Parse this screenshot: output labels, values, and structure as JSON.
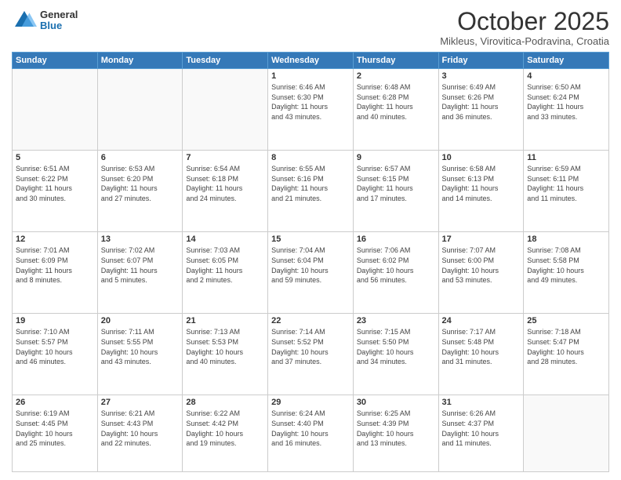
{
  "header": {
    "logo_general": "General",
    "logo_blue": "Blue",
    "month_title": "October 2025",
    "location": "Mikleus, Virovitica-Podravina, Croatia"
  },
  "days_of_week": [
    "Sunday",
    "Monday",
    "Tuesday",
    "Wednesday",
    "Thursday",
    "Friday",
    "Saturday"
  ],
  "weeks": [
    [
      {
        "day": "",
        "info": ""
      },
      {
        "day": "",
        "info": ""
      },
      {
        "day": "",
        "info": ""
      },
      {
        "day": "1",
        "info": "Sunrise: 6:46 AM\nSunset: 6:30 PM\nDaylight: 11 hours\nand 43 minutes."
      },
      {
        "day": "2",
        "info": "Sunrise: 6:48 AM\nSunset: 6:28 PM\nDaylight: 11 hours\nand 40 minutes."
      },
      {
        "day": "3",
        "info": "Sunrise: 6:49 AM\nSunset: 6:26 PM\nDaylight: 11 hours\nand 36 minutes."
      },
      {
        "day": "4",
        "info": "Sunrise: 6:50 AM\nSunset: 6:24 PM\nDaylight: 11 hours\nand 33 minutes."
      }
    ],
    [
      {
        "day": "5",
        "info": "Sunrise: 6:51 AM\nSunset: 6:22 PM\nDaylight: 11 hours\nand 30 minutes."
      },
      {
        "day": "6",
        "info": "Sunrise: 6:53 AM\nSunset: 6:20 PM\nDaylight: 11 hours\nand 27 minutes."
      },
      {
        "day": "7",
        "info": "Sunrise: 6:54 AM\nSunset: 6:18 PM\nDaylight: 11 hours\nand 24 minutes."
      },
      {
        "day": "8",
        "info": "Sunrise: 6:55 AM\nSunset: 6:16 PM\nDaylight: 11 hours\nand 21 minutes."
      },
      {
        "day": "9",
        "info": "Sunrise: 6:57 AM\nSunset: 6:15 PM\nDaylight: 11 hours\nand 17 minutes."
      },
      {
        "day": "10",
        "info": "Sunrise: 6:58 AM\nSunset: 6:13 PM\nDaylight: 11 hours\nand 14 minutes."
      },
      {
        "day": "11",
        "info": "Sunrise: 6:59 AM\nSunset: 6:11 PM\nDaylight: 11 hours\nand 11 minutes."
      }
    ],
    [
      {
        "day": "12",
        "info": "Sunrise: 7:01 AM\nSunset: 6:09 PM\nDaylight: 11 hours\nand 8 minutes."
      },
      {
        "day": "13",
        "info": "Sunrise: 7:02 AM\nSunset: 6:07 PM\nDaylight: 11 hours\nand 5 minutes."
      },
      {
        "day": "14",
        "info": "Sunrise: 7:03 AM\nSunset: 6:05 PM\nDaylight: 11 hours\nand 2 minutes."
      },
      {
        "day": "15",
        "info": "Sunrise: 7:04 AM\nSunset: 6:04 PM\nDaylight: 10 hours\nand 59 minutes."
      },
      {
        "day": "16",
        "info": "Sunrise: 7:06 AM\nSunset: 6:02 PM\nDaylight: 10 hours\nand 56 minutes."
      },
      {
        "day": "17",
        "info": "Sunrise: 7:07 AM\nSunset: 6:00 PM\nDaylight: 10 hours\nand 53 minutes."
      },
      {
        "day": "18",
        "info": "Sunrise: 7:08 AM\nSunset: 5:58 PM\nDaylight: 10 hours\nand 49 minutes."
      }
    ],
    [
      {
        "day": "19",
        "info": "Sunrise: 7:10 AM\nSunset: 5:57 PM\nDaylight: 10 hours\nand 46 minutes."
      },
      {
        "day": "20",
        "info": "Sunrise: 7:11 AM\nSunset: 5:55 PM\nDaylight: 10 hours\nand 43 minutes."
      },
      {
        "day": "21",
        "info": "Sunrise: 7:13 AM\nSunset: 5:53 PM\nDaylight: 10 hours\nand 40 minutes."
      },
      {
        "day": "22",
        "info": "Sunrise: 7:14 AM\nSunset: 5:52 PM\nDaylight: 10 hours\nand 37 minutes."
      },
      {
        "day": "23",
        "info": "Sunrise: 7:15 AM\nSunset: 5:50 PM\nDaylight: 10 hours\nand 34 minutes."
      },
      {
        "day": "24",
        "info": "Sunrise: 7:17 AM\nSunset: 5:48 PM\nDaylight: 10 hours\nand 31 minutes."
      },
      {
        "day": "25",
        "info": "Sunrise: 7:18 AM\nSunset: 5:47 PM\nDaylight: 10 hours\nand 28 minutes."
      }
    ],
    [
      {
        "day": "26",
        "info": "Sunrise: 6:19 AM\nSunset: 4:45 PM\nDaylight: 10 hours\nand 25 minutes."
      },
      {
        "day": "27",
        "info": "Sunrise: 6:21 AM\nSunset: 4:43 PM\nDaylight: 10 hours\nand 22 minutes."
      },
      {
        "day": "28",
        "info": "Sunrise: 6:22 AM\nSunset: 4:42 PM\nDaylight: 10 hours\nand 19 minutes."
      },
      {
        "day": "29",
        "info": "Sunrise: 6:24 AM\nSunset: 4:40 PM\nDaylight: 10 hours\nand 16 minutes."
      },
      {
        "day": "30",
        "info": "Sunrise: 6:25 AM\nSunset: 4:39 PM\nDaylight: 10 hours\nand 13 minutes."
      },
      {
        "day": "31",
        "info": "Sunrise: 6:26 AM\nSunset: 4:37 PM\nDaylight: 10 hours\nand 11 minutes."
      },
      {
        "day": "",
        "info": ""
      }
    ]
  ]
}
